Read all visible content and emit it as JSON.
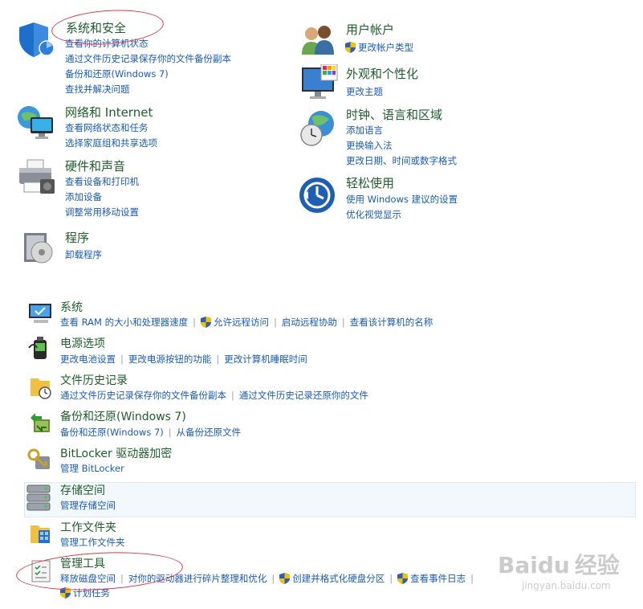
{
  "categories_left": [
    {
      "title": "系统和安全",
      "links": [
        "查看你的计算机状态",
        "通过文件历史记录保存你的文件备份副本",
        "备份和还原(Windows 7)",
        "查找并解决问题"
      ]
    },
    {
      "title": "网络和 Internet",
      "links": [
        "查看网络状态和任务",
        "选择家庭组和共享选项"
      ]
    },
    {
      "title": "硬件和声音",
      "links": [
        "查看设备和打印机",
        "添加设备",
        "调整常用移动设置"
      ]
    },
    {
      "title": "程序",
      "links": [
        "卸载程序"
      ]
    }
  ],
  "categories_right": [
    {
      "title": "用户帐户",
      "links": [
        "更改帐户类型"
      ]
    },
    {
      "title": "外观和个性化",
      "links": [
        "更改主题"
      ]
    },
    {
      "title": "时钟、语言和区域",
      "links": [
        "添加语言",
        "更换输入法",
        "更改日期、时间或数字格式"
      ]
    },
    {
      "title": "轻松使用",
      "links": [
        "使用 Windows 建议的设置",
        "优化视觉显示"
      ]
    }
  ],
  "system_items": [
    {
      "title": "系统",
      "links": [
        "查看 RAM 的大小和处理器速度",
        "允许远程访问",
        "启动远程协助",
        "查看该计算机的名称"
      ]
    },
    {
      "title": "电源选项",
      "links": [
        "更改电池设置",
        "更改电源按钮的功能",
        "更改计算机睡眠时间"
      ]
    },
    {
      "title": "文件历史记录",
      "links": [
        "通过文件历史记录保存你的文件备份副本",
        "通过文件历史记录还原你的文件"
      ]
    },
    {
      "title": "备份和还原(Windows 7)",
      "links": [
        "备份和还原(Windows 7)",
        "从备份还原文件"
      ]
    },
    {
      "title": "BitLocker 驱动器加密",
      "links": [
        "管理 BitLocker"
      ]
    },
    {
      "title": "存储空间",
      "links": [
        "管理存储空间"
      ]
    },
    {
      "title": "工作文件夹",
      "links": [
        "管理工作文件夹"
      ]
    },
    {
      "title": "管理工具",
      "links": [
        "释放磁盘空间",
        "对你的驱动器进行碎片整理和优化",
        "创建并格式化硬盘分区",
        "查看事件日志",
        "计划任务"
      ]
    }
  ],
  "watermark": {
    "brand": "Baidu",
    "brand_cn": "经验",
    "url": "jingyan.baidu.com"
  },
  "colors": {
    "title": "#1e5e2a",
    "link": "#1a5bb8",
    "annotation": "#d93a4a"
  }
}
